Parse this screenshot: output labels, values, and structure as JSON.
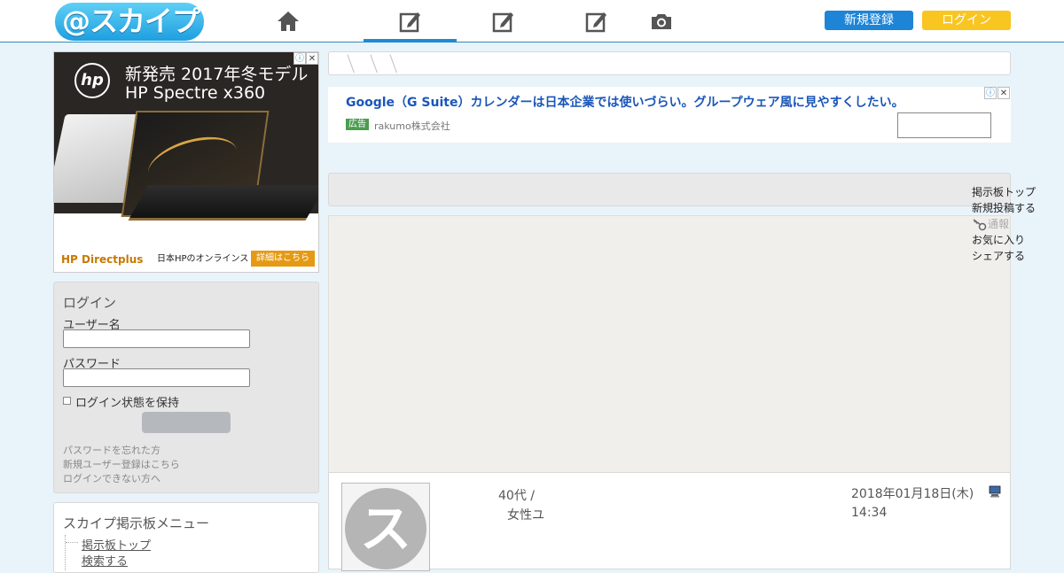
{
  "header": {
    "logo_text": "@スカイプ",
    "nav_tabs": [
      {
        "icon": "home-icon",
        "active": false
      },
      {
        "icon": "edit-icon",
        "active": true
      },
      {
        "icon": "edit-icon",
        "active": false
      },
      {
        "icon": "edit-icon",
        "active": false
      },
      {
        "icon": "camera-icon",
        "active": false
      }
    ],
    "register_label": "新規登録",
    "login_label": "ログイン",
    "colors": {
      "accent": "#1e8ad0",
      "register": "#1e84d6",
      "login": "#f9c521"
    }
  },
  "ad_left": {
    "badge": "hp",
    "line1": "新発売 2017年冬モデル",
    "line2": "HP Spectre x360",
    "brand": "HP Directplus",
    "store": "日本HPのオンラインストア",
    "cta": "詳細はこちら"
  },
  "login_box": {
    "title": "ログイン",
    "user_label": "ユーザー名",
    "password_label": "パスワード",
    "remember_label": "ログイン状態を保持",
    "link1": "パスワードを忘れた方",
    "link2": "新規ユーザー登録はこちら",
    "link3": "ログインできない方へ"
  },
  "box_links": {
    "title": "スカイプ掲示板メニュー",
    "items": [
      "掲示板トップ",
      "検索する"
    ]
  },
  "ad_banner": {
    "headline": "Google（G Suite）カレンダーは日本企業では使いづらい。グループウェア風に見やすくしたい。",
    "tag": "広告",
    "advertiser": "rakumo株式会社"
  },
  "right_menu": {
    "items": [
      "掲示板トップ",
      "新規投稿する",
      "通報",
      "お気に入り",
      "シェアする"
    ]
  },
  "post": {
    "meta1": "40代 /",
    "meta2": "女性ユ",
    "date": "2018年01月18日(木) 14:34"
  }
}
